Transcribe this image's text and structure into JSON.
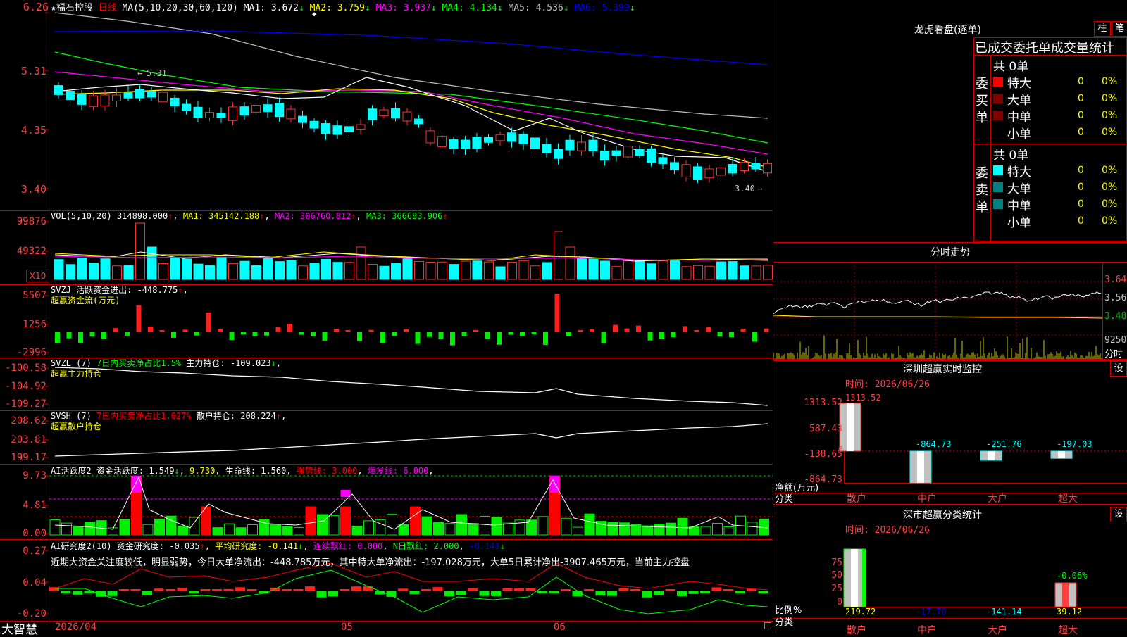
{
  "app": {
    "brand": "大智慧"
  },
  "header": {
    "star": "★",
    "stock_name": "福石控股",
    "period": "日线",
    "ma_params": "MA(5,10,20,30,60,120)",
    "ma": [
      {
        "label": "MA1: 3.672",
        "color": "#ffffff"
      },
      {
        "label": "MA2: 3.759",
        "color": "#ffff00"
      },
      {
        "label": "MA3: 3.937",
        "color": "#ff00ff"
      },
      {
        "label": "MA4: 4.134",
        "color": "#00ff00"
      },
      {
        "label": "MA5: 4.536",
        "color": "#c0c0c0"
      },
      {
        "label": "MA6: 5.399",
        "color": "#0000ff"
      }
    ]
  },
  "price_panel": {
    "y_labels": [
      "6.26",
      "5.31",
      "4.35",
      "3.40"
    ],
    "high_annotation": "5.31",
    "low_annotation": "3.40"
  },
  "vol_panel": {
    "title": "VOL(5,10,20)",
    "value": "314898.000",
    "ma1": "MA1: 345142.188",
    "ma2": "MA2: 306760.812",
    "ma3": "MA3: 366683.906",
    "y_labels": [
      "99876",
      "49322"
    ],
    "unit": "X10"
  },
  "svzj_panel": {
    "title": "SVZJ  活跃资金进出: -448.775",
    "subtitle": "超赢资金流(万元)",
    "y_labels": [
      "5507",
      "1256",
      "-2996"
    ]
  },
  "svzl_panel": {
    "title": "SVZL (7)",
    "desc": "7日内买卖净占比1.5%",
    "value": "主力持仓: -109.023",
    "subtitle": "超赢主力持仓",
    "y_labels": [
      "-100.58",
      "-104.92",
      "-109.27"
    ]
  },
  "svsh_panel": {
    "title": "SVSH (7)",
    "desc": "7日内买卖净占比1.027%",
    "value": "散户持仓: 208.224",
    "subtitle": "超赢散户持仓",
    "y_labels": [
      "208.62",
      "203.81",
      "199.17"
    ]
  },
  "ai_active_panel": {
    "title": "AI活跃度2 资金活跃度: 1.549",
    "v2": "9.730",
    "v3": "生命线: 1.560",
    "v4": "强势线: 3.000",
    "v5": "爆发线: 6.000",
    "y_labels": [
      "9.73",
      "4.81",
      "0.00"
    ]
  },
  "ai_research_panel": {
    "title": "AI研究度2(10) 资金研究度: -0.035",
    "v2": "平均研究度: -0.141",
    "v3": "连续飘红: 0.000",
    "v4": "N日飘红: 2.000",
    "v5": "-0.141",
    "note": "近期大资金关注度较低，明显弱势，今日大单净流出：-448.785万元，其中特大单净流出：-197.028万元，大单5日累计净出-3907.465万元，当前主力控盘",
    "y_labels": [
      "0.27",
      "0.04",
      "-0.20"
    ]
  },
  "x_axis": {
    "labels": [
      "2026/04",
      "05",
      "06"
    ]
  },
  "lhb": {
    "title": "龙虎看盘(逐单)",
    "btn_bar": "柱",
    "btn_pen": "笔",
    "tabs": [
      "已成交",
      "委托单",
      "成交量统计"
    ],
    "buy_label": "委买单",
    "sell_label": "委卖单",
    "buy_total": "共 0单",
    "sell_total": "共 0单",
    "buy_rows": [
      {
        "name": "特大",
        "count": "0",
        "pct": "0%",
        "color": "#ff0000"
      },
      {
        "name": "大单",
        "count": "0",
        "pct": "0%",
        "color": "#800000"
      },
      {
        "name": "中单",
        "count": "0",
        "pct": "0%",
        "color": "#800000"
      },
      {
        "name": "小单",
        "count": "0",
        "pct": "0%",
        "color": "#000000"
      }
    ],
    "sell_rows": [
      {
        "name": "特大",
        "count": "0",
        "pct": "0%",
        "color": "#00ffff"
      },
      {
        "name": "大单",
        "count": "0",
        "pct": "0%",
        "color": "#008080"
      },
      {
        "name": "中单",
        "count": "0",
        "pct": "0%",
        "color": "#008080"
      },
      {
        "name": "小单",
        "count": "0",
        "pct": "0%",
        "color": "#000000"
      }
    ]
  },
  "intraday": {
    "title": "分时走势",
    "y_labels": [
      "3.640",
      "3.560",
      "3.480"
    ],
    "vol_label": "9250",
    "unit": "分时"
  },
  "sz_monitor": {
    "title": "深圳超赢实时监控",
    "btn": "设",
    "time": "时间: 2026/06/26",
    "y_labels": [
      "1313.52",
      "587.43",
      "-138.65",
      "-864.73"
    ],
    "zero": "0",
    "side_label_1": "净额(万元)",
    "side_label_2": "分类",
    "categories": [
      "散户",
      "中户",
      "大户",
      "超大"
    ],
    "bar_values": [
      "1313.52",
      "-864.73",
      "-251.76",
      "-197.03"
    ]
  },
  "sz_class": {
    "title": "深市超赢分类统计",
    "btn": "设",
    "time": "时间: 2026/06/26",
    "y_labels": [
      "75",
      "50",
      "25",
      "0"
    ],
    "side_label_1": "比例%",
    "side_label_2": "分类",
    "categories": [
      "散户",
      "中户",
      "大户",
      "超大"
    ],
    "values": [
      "219.72",
      "-17.70",
      "-141.14",
      "39.12"
    ],
    "annotation": "-0.06%"
  }
}
